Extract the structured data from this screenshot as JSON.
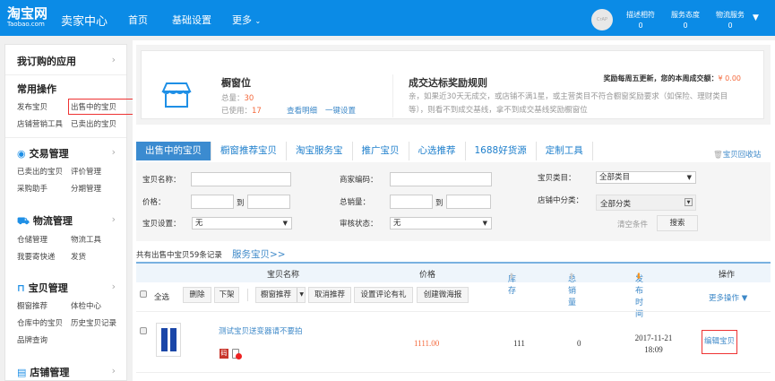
{
  "header": {
    "logo": "淘宝网",
    "logo_sub": "Taobao.com",
    "title": "卖家中心",
    "nav": [
      "首页",
      "基础设置",
      "更多"
    ],
    "avatar_text": "CrAP",
    "scores": [
      {
        "label": "描述相符",
        "value": "0"
      },
      {
        "label": "服务态度",
        "value": "0"
      },
      {
        "label": "物流服务",
        "value": "0"
      }
    ]
  },
  "sidebar": {
    "subscribed": "我订购的应用",
    "common": {
      "title": "常用操作",
      "items": [
        "发布宝贝",
        "出售中的宝贝",
        "店铺营销工具",
        "已卖出的宝贝"
      ]
    },
    "sections": [
      {
        "title": "交易管理",
        "items": [
          "已卖出的宝贝",
          "评价管理",
          "采购助手",
          "分期管理"
        ]
      },
      {
        "title": "物流管理",
        "items": [
          "仓储管理",
          "物流工具",
          "我要寄快递",
          "发货"
        ]
      },
      {
        "title": "宝贝管理",
        "items": [
          "橱窗推荐",
          "体检中心",
          "仓库中的宝贝",
          "历史宝贝记录",
          "品牌查询"
        ]
      },
      {
        "title": "店铺管理",
        "items": []
      }
    ]
  },
  "showcase": {
    "title": "橱窗位",
    "total_label": "总量：",
    "total": "30",
    "used_label": "已使用：",
    "used": "17",
    "detail_link": "查看明细",
    "one_click": "一键设置",
    "rule_title": "成交达标奖励规则",
    "weekly_label": "奖励每周五更新，您的本周成交额：",
    "weekly_amount": "¥ 0.00",
    "rule_text": "亲，如果近30天无成交，或店铺不满1星，或主营类目不符合橱窗奖励要求（如保险、理财类目等），则看不到成交基线，拿不到成交基线奖励橱窗位"
  },
  "tabs": [
    "出售中的宝贝",
    "橱窗推荐宝贝",
    "淘宝服务宝",
    "推广宝贝",
    "心选推荐",
    "1688好货源",
    "定制工具"
  ],
  "recycle": "宝贝回收站",
  "filter": {
    "name_label": "宝贝名称：",
    "code_label": "商家编码：",
    "category_label": "宝贝类目：",
    "category_value": "全部类目",
    "price_label": "价格：",
    "to": "到",
    "sales_label": "总销量：",
    "shop_cat_label": "店铺中分类：",
    "shop_cat_value": "全部分类",
    "setting_label": "宝贝设置：",
    "setting_value": "无",
    "audit_label": "审核状态：",
    "audit_value": "无",
    "clear": "清空条件",
    "search": "搜索"
  },
  "summary": "共有出售中宝贝59条记录",
  "service_link": "服务宝贝>>",
  "columns": [
    "宝贝名称",
    "价格",
    "库存",
    "总销量",
    "发布时间",
    "操作"
  ],
  "bulk": {
    "select_all": "全选",
    "buttons": [
      "删除",
      "下架",
      "橱窗推荐",
      "取消推荐",
      "设置评论有礼",
      "创建微海报"
    ],
    "more": "更多操作 ▼"
  },
  "items": [
    {
      "title": "测试宝贝送变器请不要拍",
      "badge": "码",
      "price": "1111.00",
      "stock": "111",
      "sales": "0",
      "date": "2017-11-21",
      "time": "18:09",
      "action": "编辑宝贝"
    }
  ]
}
